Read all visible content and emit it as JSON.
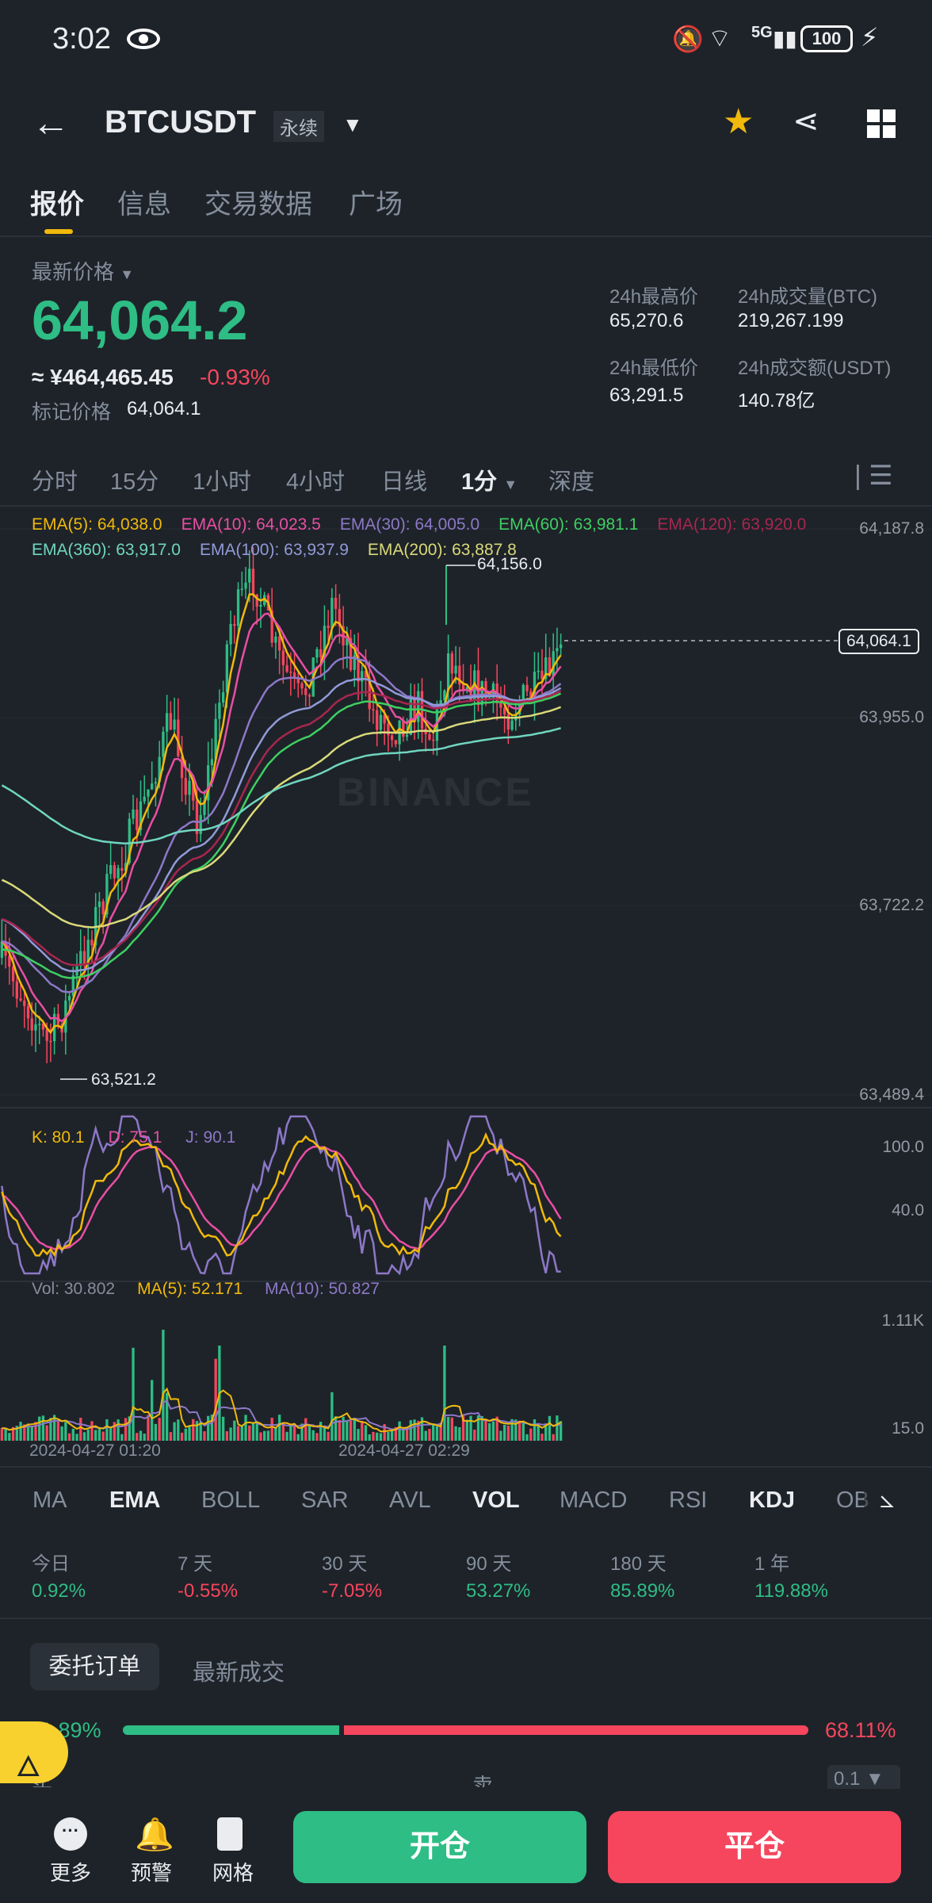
{
  "status": {
    "time": "3:02",
    "battery": "100",
    "network": "5G"
  },
  "header": {
    "symbol": "BTCUSDT",
    "contract": "永续"
  },
  "tabs": [
    "报价",
    "信息",
    "交易数据",
    "广场"
  ],
  "price": {
    "label": "最新价格",
    "last": "64,064.2",
    "cny": "≈ ¥464,465.45",
    "change": "-0.93%",
    "mark_label": "标记价格",
    "mark": "64,064.1"
  },
  "stats": {
    "high_label": "24h最高价",
    "high": "65,270.6",
    "vol_label": "24h成交量(BTC)",
    "vol": "219,267.199",
    "low_label": "24h最低价",
    "low": "63,291.5",
    "amt_label": "24h成交额(USDT)",
    "amt": "140.78亿"
  },
  "intervals": [
    "分时",
    "15分",
    "1小时",
    "4小时",
    "日线",
    "1分",
    "深度"
  ],
  "ema": [
    "EMA(5): 64,038.0",
    "EMA(10): 64,023.5",
    "EMA(30): 64,005.0",
    "EMA(60): 63,981.1",
    "EMA(120): 63,920.0",
    "EMA(360): 63,917.0",
    "EMA(100): 63,937.9",
    "EMA(200): 63,887.8"
  ],
  "colors": {
    "green": "#2ebd85",
    "red": "#f6465d",
    "accent": "#f0b90b"
  },
  "axis": [
    "64,187.8",
    "63,955.0",
    "63,722.2",
    "63,489.4"
  ],
  "marks": {
    "high": "64,156.0",
    "low": "63,521.2",
    "current": "64,064.1"
  },
  "watermark": "BINANCE",
  "kdj": {
    "k": "K: 80.1",
    "d": "D: 75.1",
    "j": "J: 90.1",
    "axis": [
      "100.0",
      "40.0"
    ]
  },
  "vol": {
    "vol": "Vol: 30.802",
    "ma5": "MA(5): 52.171",
    "ma10": "MA(10): 50.827",
    "axis": [
      "1.11K",
      "15.0"
    ]
  },
  "dates": [
    "2024-04-27 01:20",
    "2024-04-27 02:29"
  ],
  "indicators": [
    "MA",
    "EMA",
    "BOLL",
    "SAR",
    "AVL",
    "VOL",
    "MACD",
    "RSI",
    "KDJ",
    "OB"
  ],
  "perf": [
    {
      "l": "今日",
      "v": "0.92%"
    },
    {
      "l": "7 天",
      "v": "-0.55%"
    },
    {
      "l": "30 天",
      "v": "-7.05%"
    },
    {
      "l": "90 天",
      "v": "53.27%"
    },
    {
      "l": "180 天",
      "v": "85.89%"
    },
    {
      "l": "1 年",
      "v": "119.88%"
    }
  ],
  "book": {
    "tab1": "委托订单",
    "tab2": "最新成交",
    "buy_pct": "31.89%",
    "sell_pct": "68.11%",
    "buy_ratio": 0.3189,
    "buy": "买",
    "sell": "卖",
    "step": "0.1"
  },
  "bottom": {
    "more": "更多",
    "alert": "预警",
    "grid": "网格",
    "open": "开仓",
    "close": "平仓"
  }
}
